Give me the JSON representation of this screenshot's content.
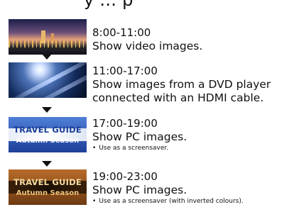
{
  "header": {
    "clipped_text": "y        ...        p"
  },
  "schedule": [
    {
      "time": "8:00-11:00",
      "description": "Show video images.",
      "note": ""
    },
    {
      "time": "11:00-17:00",
      "description": "Show images from a DVD player",
      "description2": "connected with an HDMI cable.",
      "note": ""
    },
    {
      "time": "17:00-19:00",
      "description": "Show PC images.",
      "note": "Use as a screensaver."
    },
    {
      "time": "19:00-23:00",
      "description": "Show PC images.",
      "note": "Use as a screensaver (with inverted colours)."
    }
  ],
  "thumbnails": {
    "travel_guide_title": "TRAVEL GUIDE",
    "travel_guide_subtitle": "Autumn Season"
  },
  "icons": {
    "bullet": "•",
    "arrow": "down-arrow-icon"
  }
}
